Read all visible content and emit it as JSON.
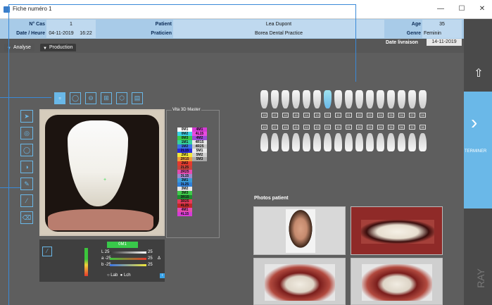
{
  "window": {
    "title": "Fiche numéro 1",
    "buttons": [
      "—",
      "☐",
      "✕"
    ]
  },
  "info": {
    "n_cas_label": "N° Cas",
    "n_cas": "1",
    "date_label": "Date / Heure",
    "date": "04-11-2019",
    "time": "16:22",
    "patient_label": "Patient",
    "patient": "Lea Dupont",
    "praticien_label": "Praticien",
    "praticien": "Borea Dental Practice",
    "age_label": "Age",
    "age": "35",
    "genre_label": "Genre",
    "genre": "Feminin",
    "livraison_label": "Date livraison",
    "livraison": "14-11-2019"
  },
  "tabs": [
    {
      "label": "Analyse"
    },
    {
      "label": "Production"
    }
  ],
  "vita": {
    "title": "Vita 3D Master",
    "shades": [
      {
        "l": "0M1",
        "r": "4M1",
        "lc": "#ffffff",
        "rc": "#d63bd6"
      },
      {
        "l": "0M2",
        "r": "4L15",
        "lc": "#3ad0e6",
        "rc": "#e84ae0"
      },
      {
        "l": "0M3",
        "r": "4M2",
        "lc": "#38c94a",
        "rc": "#9a4cd8"
      },
      {
        "l": "1M1",
        "r": "4R15",
        "lc": "#35d29c",
        "rc": "#e6e6e6"
      },
      {
        "l": "1M2",
        "r": "4R25",
        "lc": "#3a73e6",
        "rc": "#c6c6c6"
      },
      {
        "l": "2L15",
        "r": "5M1",
        "lc": "#2b2bd6",
        "rc": "#eaeaea"
      },
      {
        "l": "2M1",
        "r": "5M2",
        "lc": "#f0e63a",
        "rc": "#cfcfcf"
      },
      {
        "l": "2R15",
        "r": "5M3",
        "lc": "#f09a3a",
        "rc": "#a8a8a8"
      },
      {
        "l": "2M2",
        "r": "",
        "lc": "#e6392d",
        "rc": ""
      },
      {
        "l": "2L25",
        "r": "",
        "lc": "#c7433a",
        "rc": ""
      },
      {
        "l": "2R25",
        "r": "",
        "lc": "#e64bb0",
        "rc": ""
      },
      {
        "l": "3L15",
        "r": "",
        "lc": "#9a8acd",
        "rc": ""
      },
      {
        "l": "3M1",
        "r": "",
        "lc": "#3a9ad8",
        "rc": ""
      },
      {
        "l": "3L25",
        "r": "",
        "lc": "#2f7fd8",
        "rc": ""
      },
      {
        "l": "3M2",
        "r": "",
        "lc": "#e6e6e6",
        "rc": ""
      },
      {
        "l": "3M3",
        "r": "",
        "lc": "#3fc94a",
        "rc": ""
      },
      {
        "l": "3R15",
        "r": "",
        "lc": "#1e8a2f",
        "rc": ""
      },
      {
        "l": "3R25",
        "r": "",
        "lc": "#e63a5a",
        "rc": ""
      },
      {
        "l": "4L25",
        "r": "",
        "lc": "#c02828",
        "rc": ""
      },
      {
        "l": "4M1",
        "r": "",
        "lc": "#e64bb0",
        "rc": ""
      },
      {
        "l": "4L15",
        "r": "",
        "lc": "#d63bd6",
        "rc": ""
      }
    ]
  },
  "lab": {
    "shade": "0M1",
    "l_min": "25",
    "l_max": "25",
    "a_min": "-25",
    "a_max": "25",
    "b_min": "-25",
    "b_max": "25",
    "l_label": "L",
    "a_label": "a",
    "b_label": "b",
    "delta": "Δ",
    "mode_lab": "Lab",
    "mode_lch": "Lch"
  },
  "teeth": {
    "upper_numbers": [
      "18",
      "17",
      "16",
      "15",
      "14",
      "13",
      "12",
      "11",
      "21",
      "22",
      "23",
      "24",
      "25",
      "26",
      "27",
      "28"
    ],
    "lower_numbers": [
      "48",
      "47",
      "46",
      "45",
      "44",
      "43",
      "42",
      "41",
      "31",
      "32",
      "33",
      "34",
      "35",
      "36",
      "37",
      "38"
    ],
    "selected_index": 6
  },
  "photos": {
    "title": "Photos patient"
  },
  "side": {
    "terminer": "TERMINER",
    "brand": "RAY"
  },
  "colors": {
    "accent": "#6ab8e8",
    "header_bg": "#a8cbe8",
    "main_bg": "#5e5e5e"
  }
}
